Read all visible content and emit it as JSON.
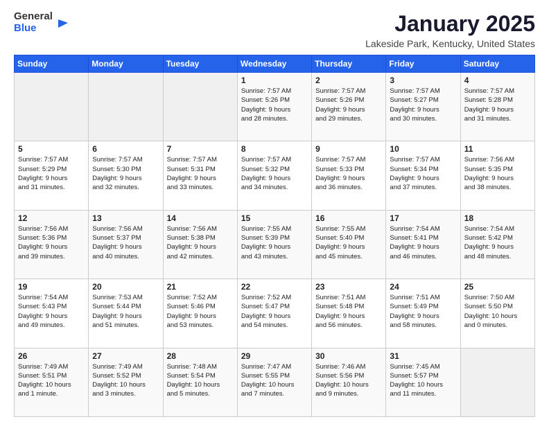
{
  "header": {
    "logo_general": "General",
    "logo_blue": "Blue",
    "month_title": "January 2025",
    "location": "Lakeside Park, Kentucky, United States"
  },
  "calendar": {
    "days_of_week": [
      "Sunday",
      "Monday",
      "Tuesday",
      "Wednesday",
      "Thursday",
      "Friday",
      "Saturday"
    ],
    "weeks": [
      [
        {
          "day": "",
          "info": ""
        },
        {
          "day": "",
          "info": ""
        },
        {
          "day": "",
          "info": ""
        },
        {
          "day": "1",
          "info": "Sunrise: 7:57 AM\nSunset: 5:26 PM\nDaylight: 9 hours\nand 28 minutes."
        },
        {
          "day": "2",
          "info": "Sunrise: 7:57 AM\nSunset: 5:26 PM\nDaylight: 9 hours\nand 29 minutes."
        },
        {
          "day": "3",
          "info": "Sunrise: 7:57 AM\nSunset: 5:27 PM\nDaylight: 9 hours\nand 30 minutes."
        },
        {
          "day": "4",
          "info": "Sunrise: 7:57 AM\nSunset: 5:28 PM\nDaylight: 9 hours\nand 31 minutes."
        }
      ],
      [
        {
          "day": "5",
          "info": "Sunrise: 7:57 AM\nSunset: 5:29 PM\nDaylight: 9 hours\nand 31 minutes."
        },
        {
          "day": "6",
          "info": "Sunrise: 7:57 AM\nSunset: 5:30 PM\nDaylight: 9 hours\nand 32 minutes."
        },
        {
          "day": "7",
          "info": "Sunrise: 7:57 AM\nSunset: 5:31 PM\nDaylight: 9 hours\nand 33 minutes."
        },
        {
          "day": "8",
          "info": "Sunrise: 7:57 AM\nSunset: 5:32 PM\nDaylight: 9 hours\nand 34 minutes."
        },
        {
          "day": "9",
          "info": "Sunrise: 7:57 AM\nSunset: 5:33 PM\nDaylight: 9 hours\nand 36 minutes."
        },
        {
          "day": "10",
          "info": "Sunrise: 7:57 AM\nSunset: 5:34 PM\nDaylight: 9 hours\nand 37 minutes."
        },
        {
          "day": "11",
          "info": "Sunrise: 7:56 AM\nSunset: 5:35 PM\nDaylight: 9 hours\nand 38 minutes."
        }
      ],
      [
        {
          "day": "12",
          "info": "Sunrise: 7:56 AM\nSunset: 5:36 PM\nDaylight: 9 hours\nand 39 minutes."
        },
        {
          "day": "13",
          "info": "Sunrise: 7:56 AM\nSunset: 5:37 PM\nDaylight: 9 hours\nand 40 minutes."
        },
        {
          "day": "14",
          "info": "Sunrise: 7:56 AM\nSunset: 5:38 PM\nDaylight: 9 hours\nand 42 minutes."
        },
        {
          "day": "15",
          "info": "Sunrise: 7:55 AM\nSunset: 5:39 PM\nDaylight: 9 hours\nand 43 minutes."
        },
        {
          "day": "16",
          "info": "Sunrise: 7:55 AM\nSunset: 5:40 PM\nDaylight: 9 hours\nand 45 minutes."
        },
        {
          "day": "17",
          "info": "Sunrise: 7:54 AM\nSunset: 5:41 PM\nDaylight: 9 hours\nand 46 minutes."
        },
        {
          "day": "18",
          "info": "Sunrise: 7:54 AM\nSunset: 5:42 PM\nDaylight: 9 hours\nand 48 minutes."
        }
      ],
      [
        {
          "day": "19",
          "info": "Sunrise: 7:54 AM\nSunset: 5:43 PM\nDaylight: 9 hours\nand 49 minutes."
        },
        {
          "day": "20",
          "info": "Sunrise: 7:53 AM\nSunset: 5:44 PM\nDaylight: 9 hours\nand 51 minutes."
        },
        {
          "day": "21",
          "info": "Sunrise: 7:52 AM\nSunset: 5:46 PM\nDaylight: 9 hours\nand 53 minutes."
        },
        {
          "day": "22",
          "info": "Sunrise: 7:52 AM\nSunset: 5:47 PM\nDaylight: 9 hours\nand 54 minutes."
        },
        {
          "day": "23",
          "info": "Sunrise: 7:51 AM\nSunset: 5:48 PM\nDaylight: 9 hours\nand 56 minutes."
        },
        {
          "day": "24",
          "info": "Sunrise: 7:51 AM\nSunset: 5:49 PM\nDaylight: 9 hours\nand 58 minutes."
        },
        {
          "day": "25",
          "info": "Sunrise: 7:50 AM\nSunset: 5:50 PM\nDaylight: 10 hours\nand 0 minutes."
        }
      ],
      [
        {
          "day": "26",
          "info": "Sunrise: 7:49 AM\nSunset: 5:51 PM\nDaylight: 10 hours\nand 1 minute."
        },
        {
          "day": "27",
          "info": "Sunrise: 7:49 AM\nSunset: 5:52 PM\nDaylight: 10 hours\nand 3 minutes."
        },
        {
          "day": "28",
          "info": "Sunrise: 7:48 AM\nSunset: 5:54 PM\nDaylight: 10 hours\nand 5 minutes."
        },
        {
          "day": "29",
          "info": "Sunrise: 7:47 AM\nSunset: 5:55 PM\nDaylight: 10 hours\nand 7 minutes."
        },
        {
          "day": "30",
          "info": "Sunrise: 7:46 AM\nSunset: 5:56 PM\nDaylight: 10 hours\nand 9 minutes."
        },
        {
          "day": "31",
          "info": "Sunrise: 7:45 AM\nSunset: 5:57 PM\nDaylight: 10 hours\nand 11 minutes."
        },
        {
          "day": "",
          "info": ""
        }
      ]
    ]
  }
}
